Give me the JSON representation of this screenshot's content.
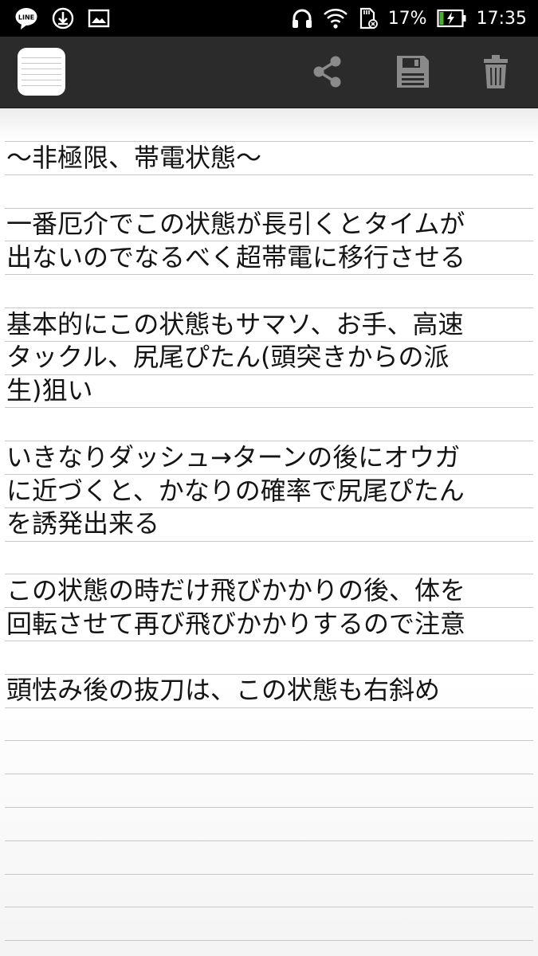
{
  "status_bar": {
    "left_icons": [
      "line-app-icon",
      "download-icon",
      "image-icon"
    ],
    "line_badge": "LINE",
    "right_icons": [
      "headphones-icon",
      "wifi-icon",
      "sd-card-icon",
      "battery-charging-icon"
    ],
    "battery_percent": "17%",
    "time": "17:35"
  },
  "toolbar": {
    "app_icon": "notepad-icon",
    "actions": [
      "share-icon",
      "save-icon",
      "delete-icon"
    ]
  },
  "note": {
    "lines": [
      "〜非極限、帯電状態〜",
      "",
      "一番厄介でこの状態が長引くとタイムが",
      "出ないのでなるべく超帯電に移行させる",
      "",
      "基本的にこの状態もサマソ、お手、高速",
      "タックル、尻尾ぴたん(頭突きからの派",
      "生)狙い",
      "",
      "いきなりダッシュ→ターンの後にオウガ",
      "に近づくと、かなりの確率で尻尾ぴたん",
      "を誘発出来る",
      "",
      "この状態の時だけ飛びかかりの後、体を",
      "回転させて再び飛びかかりするので注意",
      "",
      "頭怯み後の抜刀は、この状態も右斜め"
    ]
  }
}
